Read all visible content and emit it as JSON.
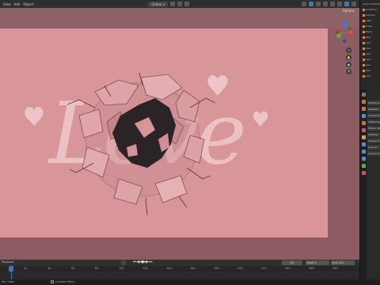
{
  "header": {
    "menu_view": "View",
    "menu_add": "Add",
    "menu_object": "Object",
    "transform_orientation": "Global",
    "options_label": "Options"
  },
  "viewport": {
    "text": "Love",
    "colors": {
      "background": "#8c5c62",
      "camera_frame": "#d8969a",
      "text_fill": "#f0c9cc",
      "hole": "#2a2426"
    }
  },
  "gizmo": {
    "x_label": "X",
    "y_label": "Y",
    "z_label": "Z"
  },
  "timeline": {
    "menu_playback": "Playback",
    "current_frame": "24",
    "start_label": "Start",
    "start_value": "1",
    "end_label": "End",
    "end_value": "121",
    "ruler_ticks": [
      "20",
      "40",
      "60",
      "80",
      "100",
      "120",
      "140",
      "160",
      "180",
      "200",
      "220",
      "240",
      "260",
      "280"
    ]
  },
  "status": {
    "left": "Pan View",
    "context_menu": "Context Menu"
  },
  "outliner": {
    "title": "Scene Collection",
    "rows": [
      "Collection",
      "Camera",
      "Light",
      "Cube",
      "Plane",
      "Text",
      "Cell",
      "Cell",
      "Cell",
      "Cell",
      "Cell",
      "Cell",
      "Cell",
      "Cell",
      "Cell",
      "Cell"
    ]
  },
  "properties": {
    "rows": [
      "Transform",
      "Relations",
      "Collections",
      "Instancing",
      "Motion Paths",
      "Visibility",
      "Viewport Display",
      "Line Art",
      "Custom Properties"
    ]
  }
}
